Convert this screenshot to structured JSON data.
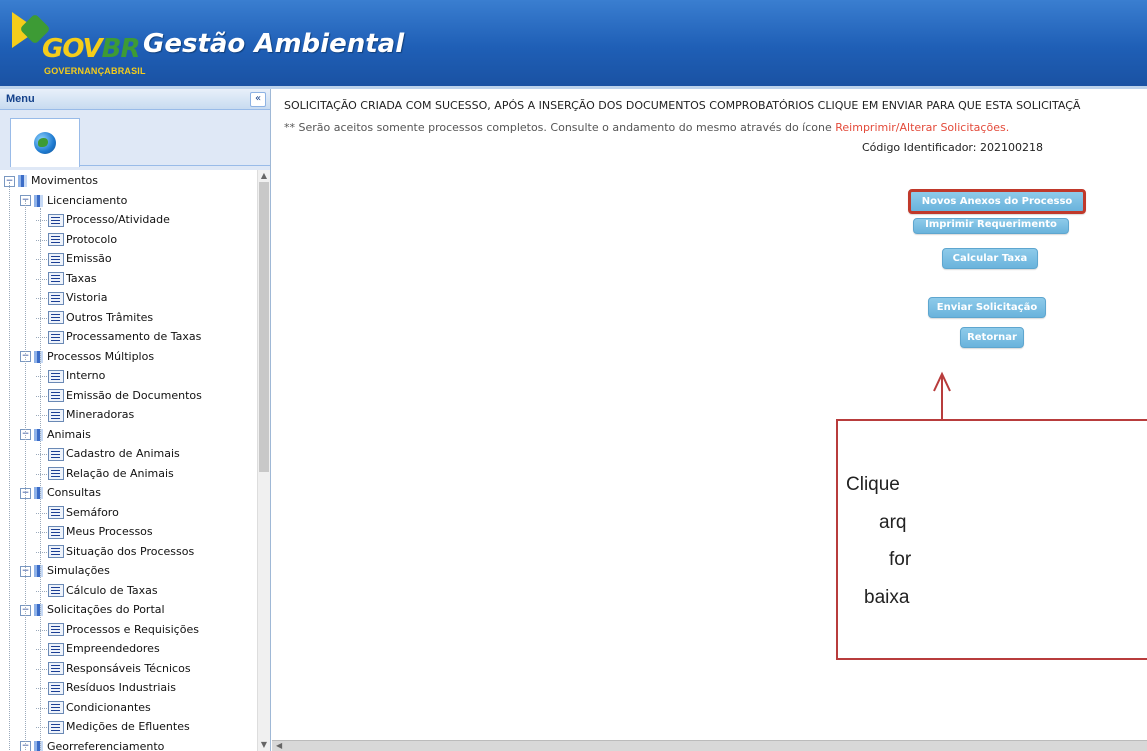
{
  "header": {
    "logo_gov": "GOV",
    "logo_br": "BR",
    "logo_sub": "GOVERNANÇABRASIL",
    "app_title": "Gestão Ambiental"
  },
  "sidebar": {
    "menu_title": "Menu",
    "collapse_glyph": "«",
    "tab_icon": "globe-icon",
    "tree": [
      {
        "label": "Movimentos",
        "type": "folder",
        "level": 0
      },
      {
        "label": "Licenciamento",
        "type": "folder",
        "level": 1
      },
      {
        "label": "Processo/Atividade",
        "type": "leaf",
        "level": 2
      },
      {
        "label": "Protocolo",
        "type": "leaf",
        "level": 2
      },
      {
        "label": "Emissão",
        "type": "leaf",
        "level": 2
      },
      {
        "label": "Taxas",
        "type": "leaf",
        "level": 2
      },
      {
        "label": "Vistoria",
        "type": "leaf",
        "level": 2
      },
      {
        "label": "Outros Trâmites",
        "type": "leaf",
        "level": 2
      },
      {
        "label": "Processamento de Taxas",
        "type": "leaf",
        "level": 2
      },
      {
        "label": "Processos Múltiplos",
        "type": "folder",
        "level": 1
      },
      {
        "label": "Interno",
        "type": "leaf",
        "level": 2
      },
      {
        "label": "Emissão de Documentos",
        "type": "leaf",
        "level": 2
      },
      {
        "label": "Mineradoras",
        "type": "leaf",
        "level": 2
      },
      {
        "label": "Animais",
        "type": "folder",
        "level": 1
      },
      {
        "label": "Cadastro de Animais",
        "type": "leaf",
        "level": 2
      },
      {
        "label": "Relação de Animais",
        "type": "leaf",
        "level": 2
      },
      {
        "label": "Consultas",
        "type": "folder",
        "level": 1
      },
      {
        "label": "Semáforo",
        "type": "leaf",
        "level": 2
      },
      {
        "label": "Meus Processos",
        "type": "leaf",
        "level": 2
      },
      {
        "label": "Situação dos Processos",
        "type": "leaf",
        "level": 2
      },
      {
        "label": "Simulações",
        "type": "folder",
        "level": 1
      },
      {
        "label": "Cálculo de Taxas",
        "type": "leaf",
        "level": 2
      },
      {
        "label": "Solicitações do Portal",
        "type": "folder",
        "level": 1
      },
      {
        "label": "Processos e Requisições",
        "type": "leaf",
        "level": 2
      },
      {
        "label": "Empreendedores",
        "type": "leaf",
        "level": 2
      },
      {
        "label": "Responsáveis Técnicos",
        "type": "leaf",
        "level": 2
      },
      {
        "label": "Resíduos Industriais",
        "type": "leaf",
        "level": 2
      },
      {
        "label": "Condicionantes",
        "type": "leaf",
        "level": 2
      },
      {
        "label": "Medições de Efluentes",
        "type": "leaf",
        "level": 2
      },
      {
        "label": "Georreferenciamento",
        "type": "folder",
        "level": 1
      }
    ]
  },
  "main": {
    "success_message": "SOLICITAÇÃO CRIADA COM SUCESSO, APÓS A INSERÇÃO DOS DOCUMENTOS COMPROBATÓRIOS CLIQUE EM ENVIAR PARA QUE ESTA SOLICITAÇÃ",
    "note_prefix": "** Serão aceitos somente processos completos. Consulte o andamento do mesmo através do ícone ",
    "note_link": "Reimprimir/Alterar Solicitações.",
    "code_label": "Código Identificador: 202100218",
    "buttons": {
      "novos_anexos": "Novos Anexos do Processo",
      "imprimir": "Imprimir Requerimento",
      "calcular": "Calcular Taxa",
      "enviar": "Enviar Solicitação",
      "retornar": "Retornar"
    },
    "callout_lines": [
      "Clique",
      "arq",
      "for",
      "baixa"
    ]
  },
  "colors": {
    "header_blue": "#1f5fb6",
    "button_blue": "#6ab3dc",
    "highlight_red": "#c0392b",
    "link_red": "#e34a3a"
  }
}
